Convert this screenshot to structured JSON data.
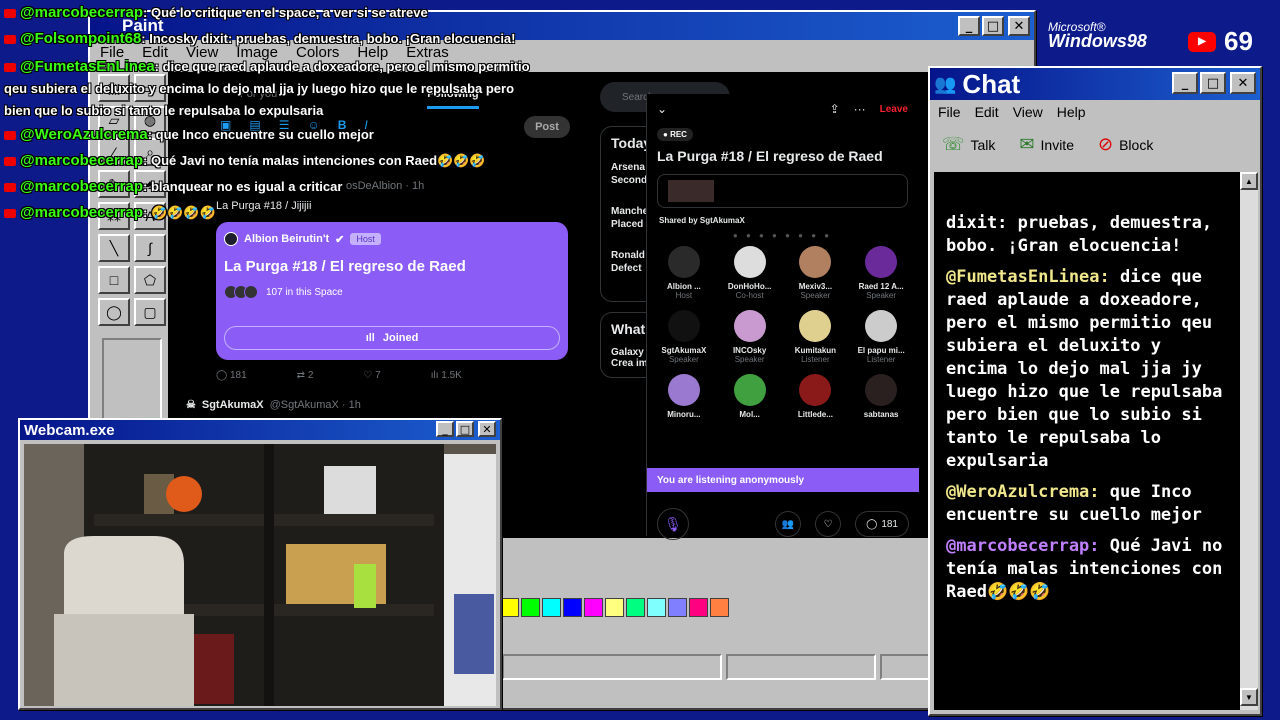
{
  "paint": {
    "title": "Paint",
    "menu": [
      "File",
      "Edit",
      "View",
      "Image",
      "Colors",
      "Help",
      "Extras"
    ],
    "palette": [
      "#ffff00",
      "#00ff00",
      "#00ffff",
      "#0000ff",
      "#ff00ff",
      "#ffff80",
      "#00ff80",
      "#80ffff",
      "#8080ff",
      "#ff0080",
      "#ff8040"
    ]
  },
  "twitter": {
    "tabs": [
      "For you",
      "Following"
    ],
    "post_label": "Post",
    "search_placeholder": "Search",
    "tweet1": {
      "handle_fragment": "osDeAlbion · 1h",
      "text": "La Purga #18 / Jijijii"
    },
    "space_card": {
      "host": "Albion Beirutin't",
      "host_badge": "Host",
      "title": "La Purga #18 / El regreso de Raed",
      "listeners": "107 in this Space",
      "joined": "Joined"
    },
    "tweet_actions": {
      "replies": "181",
      "reposts": "2",
      "likes": "7",
      "views": "1.5K"
    },
    "tweet2": {
      "name": "SgtAkumaX",
      "handle": "@SgtAkumaX · 1h"
    },
    "trends_title": "Today",
    "trends": [
      "Arsena\nSecond",
      "Manche\nPlaced",
      "Ronald\nDefect"
    ],
    "whats_title": "What",
    "whats_item": "Galaxy\nCrea im"
  },
  "space_panel": {
    "leave": "Leave",
    "rec": "REC",
    "title": "La Purga #18 / El regreso de Raed",
    "shared_by": "Shared by SgtAkumaX",
    "users": [
      {
        "name": "Albion ...",
        "role": "Host",
        "color": "#2a2a2a"
      },
      {
        "name": "DonHoHo...",
        "role": "Co-host",
        "color": "#dddddd"
      },
      {
        "name": "Mexiv3...",
        "role": "Speaker",
        "color": "#b08060"
      },
      {
        "name": "Raed 12 A...",
        "role": "Speaker",
        "color": "#6a2a9a"
      },
      {
        "name": "SgtAkumaX",
        "role": "Speaker",
        "color": "#111111"
      },
      {
        "name": "INCOsky",
        "role": "Speaker",
        "color": "#c89ad0"
      },
      {
        "name": "Kumitakun",
        "role": "Listener",
        "color": "#e0d090"
      },
      {
        "name": "El papu mi...",
        "role": "Listener",
        "color": "#cccccc"
      },
      {
        "name": "Minoru...",
        "role": "",
        "color": "#9a7ad0"
      },
      {
        "name": "Mol...",
        "role": "",
        "color": "#40a040"
      },
      {
        "name": "Littlede...",
        "role": "",
        "color": "#8a1a1a"
      },
      {
        "name": "sabtanas",
        "role": "",
        "color": "#2a2020"
      }
    ],
    "anon": "You are listening anonymously",
    "listener_count": "181"
  },
  "webcam": {
    "title": "Webcam.exe"
  },
  "chat": {
    "title": "Chat",
    "menu": [
      "File",
      "Edit",
      "View",
      "Help"
    ],
    "tools": [
      {
        "label": "Talk",
        "icon": "talk-icon"
      },
      {
        "label": "Invite",
        "icon": "invite-icon"
      },
      {
        "label": "Block",
        "icon": "block-icon"
      }
    ],
    "messages": [
      {
        "user": "",
        "text": "dixit: pruebas, demuestra, bobo. ¡Gran elocuencia!"
      },
      {
        "user": "@FumetasEnLinea:",
        "user_color": "#f0e68c",
        "text": "dice que raed aplaude a doxeadore, pero el mismo permitio qeu subiera el deluxito y encima lo dejo mal jja jy luego hizo que le repulsaba pero bien que lo subio si tanto le repulsaba lo expulsaria"
      },
      {
        "user": "@WeroAzulcrema:",
        "user_color": "#f0e68c",
        "text": "que Inco encuentre su cuello mejor"
      },
      {
        "user": "@marcobecerrap:",
        "user_color": "#c080ff",
        "text": "Qué Javi no tenía malas intenciones con Raed🤣🤣🤣"
      }
    ]
  },
  "brand": {
    "microsoft": "Microsoft®",
    "windows": "Windows98"
  },
  "viewers": {
    "count": "69"
  },
  "overlay_chat": [
    {
      "user": "@marcobecerrap",
      "text": ": Qué lo critique en el space, a ver si se atreve"
    },
    {
      "user": "@Folsompoint68",
      "text": ": Incosky dixit: pruebas, demuestra, bobo. ¡Gran elocuencia!"
    },
    {
      "user": "@FumetasEnLinea",
      "text": ": dice que raed aplaude a doxeadore, pero el mismo permitio qeu subiera el deluxito y encima lo dejo mal jja jy luego hizo que le repulsaba pero bien que lo subio si tanto le repulsaba lo expulsaria"
    },
    {
      "user": "@WeroAzulcrema",
      "text": ": que Inco encuentre su cuello mejor"
    },
    {
      "user": "@marcobecerrap",
      "text": ": Qué Javi no tenía malas intenciones con Raed🤣🤣🤣"
    },
    {
      "user": "@marcobecerrap",
      "text": ": blanquear no es igual a criticar"
    },
    {
      "user": "@marcobecerrap",
      "text": ": 🤣🤣🤣🤣"
    }
  ]
}
